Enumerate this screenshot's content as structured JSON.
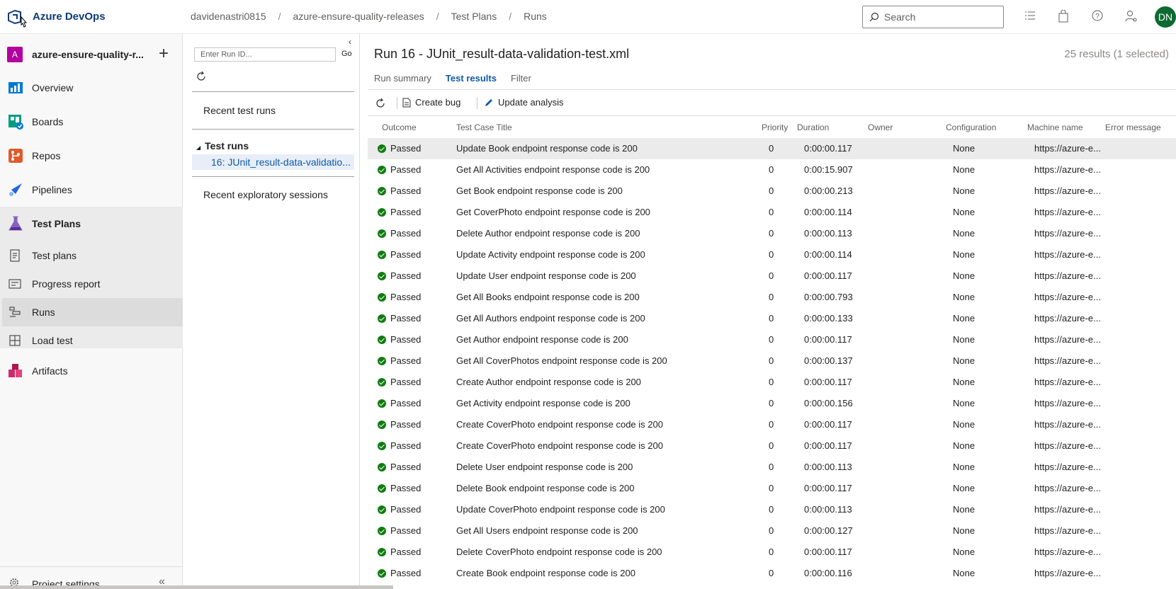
{
  "header": {
    "brand": "Azure DevOps",
    "breadcrumbs": [
      "davidenastri0815",
      "azure-ensure-quality-releases",
      "Test Plans",
      "Runs"
    ],
    "search_placeholder": "Search",
    "avatar_initials": "DN"
  },
  "sidebar": {
    "project_badge": "A",
    "project_name": "azure-ensure-quality-r...",
    "items": [
      {
        "label": "Overview",
        "icon": "overview-icon"
      },
      {
        "label": "Boards",
        "icon": "boards-icon"
      },
      {
        "label": "Repos",
        "icon": "repos-icon"
      },
      {
        "label": "Pipelines",
        "icon": "pipelines-icon"
      },
      {
        "label": "Test Plans",
        "icon": "test-plans-icon"
      },
      {
        "label": "Test plans",
        "icon": "test-plans-list-icon"
      },
      {
        "label": "Progress report",
        "icon": "progress-report-icon"
      },
      {
        "label": "Runs",
        "icon": "runs-icon"
      },
      {
        "label": "Load test",
        "icon": "load-test-icon"
      },
      {
        "label": "Artifacts",
        "icon": "artifacts-icon"
      }
    ],
    "project_settings": "Project settings"
  },
  "runs_pane": {
    "run_id_placeholder": "Enter Run ID...",
    "go_label": "Go",
    "recent_runs": "Recent test runs",
    "test_runs_header": "Test runs",
    "selected_run": "16: JUnit_result-data-validatio...",
    "recent_sessions": "Recent exploratory sessions"
  },
  "main": {
    "title": "Run 16 - JUnit_result-data-validation-test.xml",
    "result_count": "25 results (1 selected)",
    "tabs": [
      "Run summary",
      "Test results",
      "Filter"
    ],
    "active_tab": "Test results",
    "toolbar": {
      "create_bug": "Create bug",
      "update_analysis": "Update analysis"
    },
    "columns": [
      "Outcome",
      "Test Case Title",
      "Priority",
      "Duration",
      "Owner",
      "Configuration",
      "Machine name",
      "Error message"
    ],
    "rows": [
      {
        "outcome": "Passed",
        "title": "Update Book endpoint response code is 200",
        "priority": "0",
        "duration": "0:00:00.117",
        "owner": "",
        "config": "None",
        "machine": "https://azure-e...",
        "error": ""
      },
      {
        "outcome": "Passed",
        "title": "Get All Activities endpoint response code is 200",
        "priority": "0",
        "duration": "0:00:15.907",
        "owner": "",
        "config": "None",
        "machine": "https://azure-e...",
        "error": ""
      },
      {
        "outcome": "Passed",
        "title": "Get Book endpoint response code is 200",
        "priority": "0",
        "duration": "0:00:00.213",
        "owner": "",
        "config": "None",
        "machine": "https://azure-e...",
        "error": ""
      },
      {
        "outcome": "Passed",
        "title": "Get CoverPhoto endpoint response code is 200",
        "priority": "0",
        "duration": "0:00:00.114",
        "owner": "",
        "config": "None",
        "machine": "https://azure-e...",
        "error": ""
      },
      {
        "outcome": "Passed",
        "title": "Delete Author endpoint response code is 200",
        "priority": "0",
        "duration": "0:00:00.113",
        "owner": "",
        "config": "None",
        "machine": "https://azure-e...",
        "error": ""
      },
      {
        "outcome": "Passed",
        "title": "Update Activity endpoint response code is 200",
        "priority": "0",
        "duration": "0:00:00.114",
        "owner": "",
        "config": "None",
        "machine": "https://azure-e...",
        "error": ""
      },
      {
        "outcome": "Passed",
        "title": "Update User endpoint response code is 200",
        "priority": "0",
        "duration": "0:00:00.117",
        "owner": "",
        "config": "None",
        "machine": "https://azure-e...",
        "error": ""
      },
      {
        "outcome": "Passed",
        "title": "Get All Books endpoint response code is 200",
        "priority": "0",
        "duration": "0:00:00.793",
        "owner": "",
        "config": "None",
        "machine": "https://azure-e...",
        "error": ""
      },
      {
        "outcome": "Passed",
        "title": "Get All Authors endpoint response code is 200",
        "priority": "0",
        "duration": "0:00:00.133",
        "owner": "",
        "config": "None",
        "machine": "https://azure-e...",
        "error": ""
      },
      {
        "outcome": "Passed",
        "title": "Get Author endpoint response code is 200",
        "priority": "0",
        "duration": "0:00:00.117",
        "owner": "",
        "config": "None",
        "machine": "https://azure-e...",
        "error": ""
      },
      {
        "outcome": "Passed",
        "title": "Get All CoverPhotos endpoint response code is 200",
        "priority": "0",
        "duration": "0:00:00.137",
        "owner": "",
        "config": "None",
        "machine": "https://azure-e...",
        "error": ""
      },
      {
        "outcome": "Passed",
        "title": "Create Author endpoint response code is 200",
        "priority": "0",
        "duration": "0:00:00.117",
        "owner": "",
        "config": "None",
        "machine": "https://azure-e...",
        "error": ""
      },
      {
        "outcome": "Passed",
        "title": "Get Activity endpoint response code is 200",
        "priority": "0",
        "duration": "0:00:00.156",
        "owner": "",
        "config": "None",
        "machine": "https://azure-e...",
        "error": ""
      },
      {
        "outcome": "Passed",
        "title": "Create CoverPhoto endpoint response code is 200",
        "priority": "0",
        "duration": "0:00:00.117",
        "owner": "",
        "config": "None",
        "machine": "https://azure-e...",
        "error": ""
      },
      {
        "outcome": "Passed",
        "title": "Create CoverPhoto endpoint response code is 200",
        "priority": "0",
        "duration": "0:00:00.117",
        "owner": "",
        "config": "None",
        "machine": "https://azure-e...",
        "error": ""
      },
      {
        "outcome": "Passed",
        "title": "Delete User endpoint response code is 200",
        "priority": "0",
        "duration": "0:00:00.113",
        "owner": "",
        "config": "None",
        "machine": "https://azure-e...",
        "error": ""
      },
      {
        "outcome": "Passed",
        "title": "Delete Book endpoint response code is 200",
        "priority": "0",
        "duration": "0:00:00.117",
        "owner": "",
        "config": "None",
        "machine": "https://azure-e...",
        "error": ""
      },
      {
        "outcome": "Passed",
        "title": "Update CoverPhoto endpoint response code is 200",
        "priority": "0",
        "duration": "0:00:00.113",
        "owner": "",
        "config": "None",
        "machine": "https://azure-e...",
        "error": ""
      },
      {
        "outcome": "Passed",
        "title": "Get All Users endpoint response code is 200",
        "priority": "0",
        "duration": "0:00:00.127",
        "owner": "",
        "config": "None",
        "machine": "https://azure-e...",
        "error": ""
      },
      {
        "outcome": "Passed",
        "title": "Delete CoverPhoto endpoint response code is 200",
        "priority": "0",
        "duration": "0:00:00.117",
        "owner": "",
        "config": "None",
        "machine": "https://azure-e...",
        "error": ""
      },
      {
        "outcome": "Passed",
        "title": "Create Book endpoint response code is 200",
        "priority": "0",
        "duration": "0:00:00.116",
        "owner": "",
        "config": "None",
        "machine": "https://azure-e...",
        "error": ""
      }
    ],
    "selected_row": 0
  },
  "colors": {
    "accent": "#0f5aa8",
    "passed": "#107c10",
    "avatar": "#0d6a33",
    "project_badge": "#b4009e"
  }
}
